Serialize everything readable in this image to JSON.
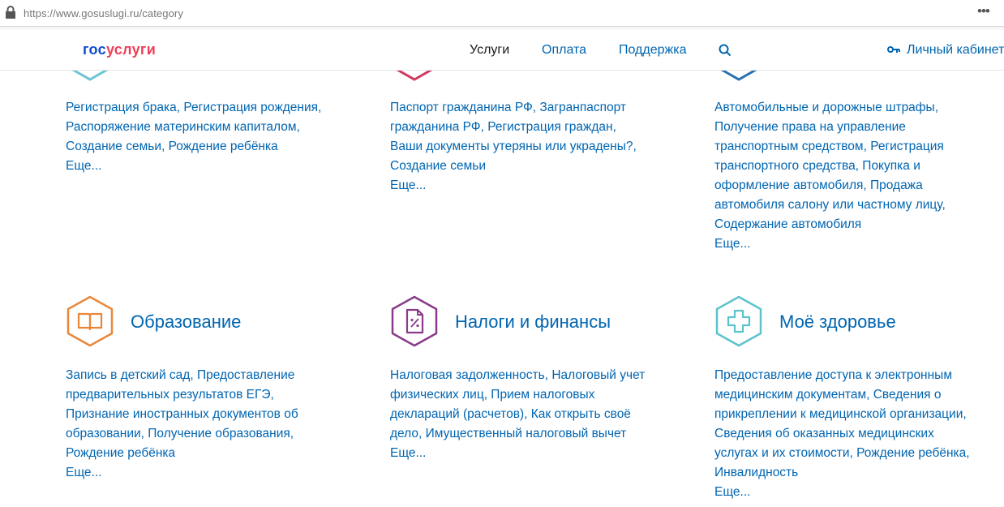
{
  "browser": {
    "url": "https://www.gosuslugi.ru/category",
    "menu_icon": "more-dots-icon"
  },
  "header": {
    "logo_part1": "гос",
    "logo_part2": "услуги",
    "nav": [
      {
        "label": "Услуги",
        "active": true
      },
      {
        "label": "Оплата",
        "active": false
      },
      {
        "label": "Поддержка",
        "active": false
      }
    ],
    "search_icon": "search-icon",
    "cabinet_label": "Личный кабинет"
  },
  "top_categories": [
    {
      "icon_color": "#6ec4d4",
      "lines": [
        "Регистрация брака, Регистрация рождения,",
        "Распоряжение материнским капиталом,",
        "Создание семьи, Рождение ребёнка"
      ],
      "more": "Еще..."
    },
    {
      "icon_color": "#d03a60",
      "lines": [
        "Паспорт гражданина РФ, Загранпаспорт",
        "гражданина РФ, Регистрация граждан,",
        "Ваши документы утеряны или украдены?,",
        "Создание семьи"
      ],
      "more": "Еще..."
    },
    {
      "icon_color": "#2a6fb0",
      "lines": [
        "Автомобильные и дорожные штрафы,",
        "Получение права на управление",
        "транспортным средством, Регистрация",
        "транспортного средства, Покупка и",
        "оформление автомобиля, Продажа",
        "автомобиля салону или частному лицу,",
        "Содержание автомобиля"
      ],
      "more": "Еще..."
    }
  ],
  "bottom_categories": [
    {
      "title": "Образование",
      "icon": "book-icon",
      "icon_color": "#e8873a",
      "lines": [
        "Запись в детский сад, Предоставление",
        "предварительных результатов ЕГЭ,",
        "Признание иностранных документов об",
        "образовании, Получение образования,",
        "Рождение ребёнка"
      ],
      "more": "Еще..."
    },
    {
      "title": "Налоги и финансы",
      "icon": "tax-document-icon",
      "icon_color": "#8a3a8c",
      "lines": [
        "Налоговая задолженность, Налоговый учет",
        "физических лиц, Прием налоговых",
        "деклараций (расчетов), Как открыть своё",
        "дело, Имущественный налоговый вычет"
      ],
      "more": "Еще..."
    },
    {
      "title": "Моё здоровье",
      "icon": "medical-cross-icon",
      "icon_color": "#5cc3cc",
      "lines": [
        "Предоставление доступа к электронным",
        "медицинским документам, Сведения о",
        "прикреплении к медицинской организации,",
        "Сведения об оказанных медицинских",
        "услугах и их стоимости, Рождение ребёнка,",
        "Инвалидность"
      ],
      "more": "Еще..."
    }
  ]
}
